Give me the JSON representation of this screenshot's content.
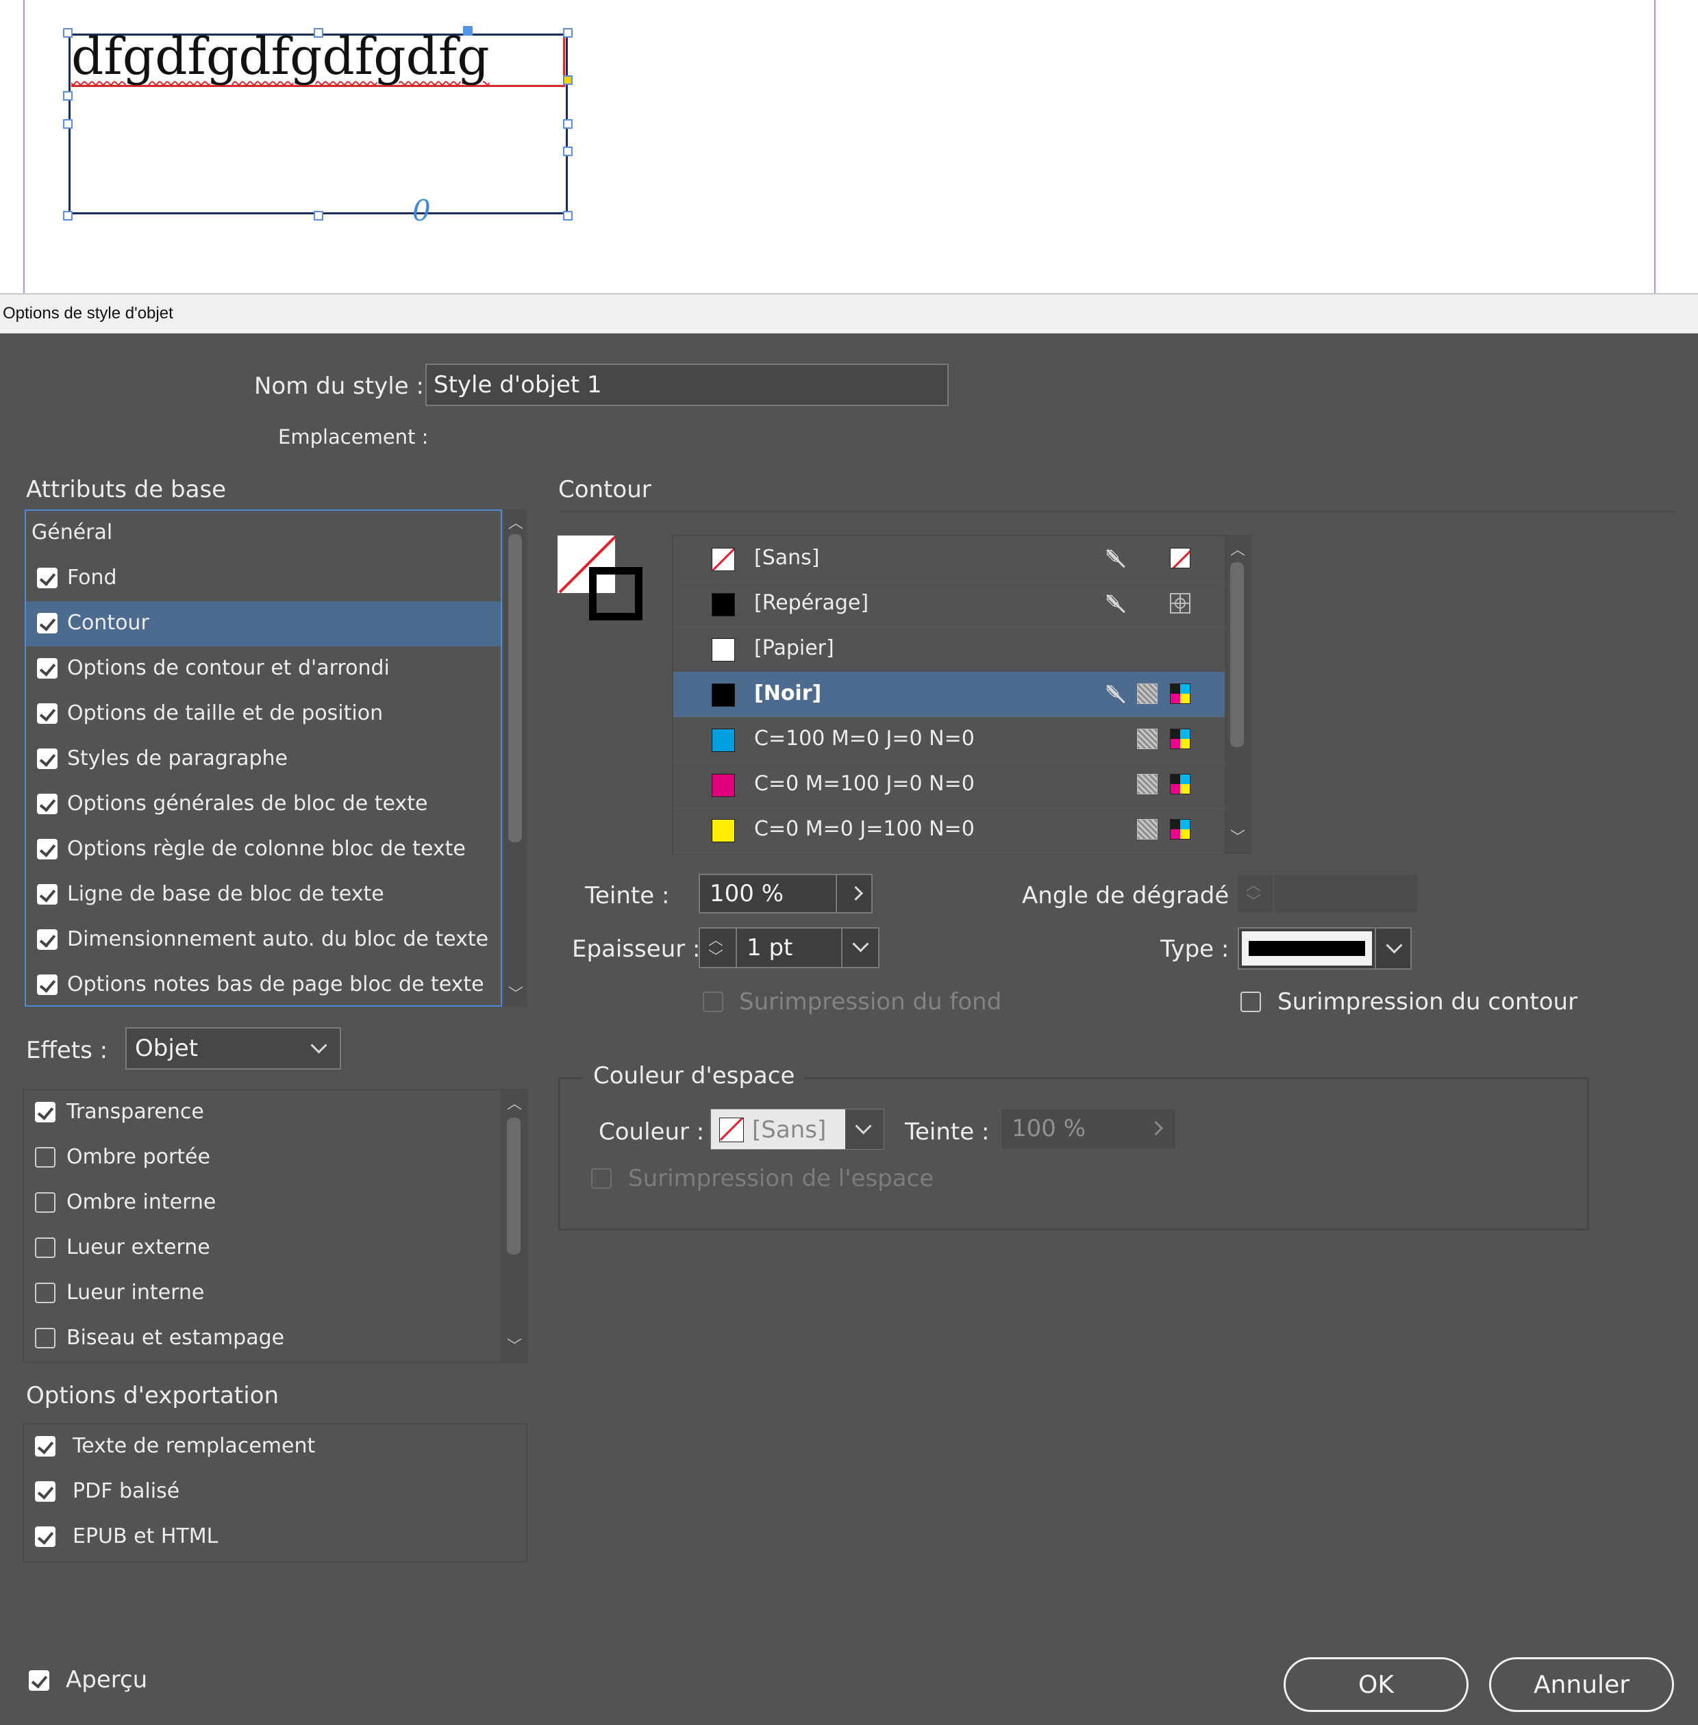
{
  "canvas": {
    "frame_text": "dfgdfgdfgdfgdfg",
    "overflow_marker": "0"
  },
  "window": {
    "title": "Options de style d'objet"
  },
  "style_name": {
    "label": "Nom du style :",
    "value": "Style d'objet 1"
  },
  "location": {
    "label": "Emplacement :"
  },
  "basic_attributes": {
    "heading": "Attributs de base",
    "items": [
      {
        "label": "Général",
        "checkbox": false,
        "checked": false
      },
      {
        "label": "Fond",
        "checkbox": true,
        "checked": true
      },
      {
        "label": "Contour",
        "checkbox": true,
        "checked": true,
        "selected": true
      },
      {
        "label": "Options de contour et d'arrondi",
        "checkbox": true,
        "checked": true
      },
      {
        "label": "Options de taille et de position",
        "checkbox": true,
        "checked": true
      },
      {
        "label": "Styles de paragraphe",
        "checkbox": true,
        "checked": true
      },
      {
        "label": "Options générales de bloc de texte",
        "checkbox": true,
        "checked": true
      },
      {
        "label": "Options règle de colonne bloc de texte",
        "checkbox": true,
        "checked": true
      },
      {
        "label": "Ligne de base de bloc de texte",
        "checkbox": true,
        "checked": true
      },
      {
        "label": "Dimensionnement auto. du bloc de texte",
        "checkbox": true,
        "checked": true
      },
      {
        "label": "Options notes bas de page bloc de texte",
        "checkbox": true,
        "checked": true
      }
    ]
  },
  "effects": {
    "label": "Effets :",
    "target": "Objet",
    "items": [
      {
        "label": "Transparence",
        "checked": true
      },
      {
        "label": "Ombre portée",
        "checked": false
      },
      {
        "label": "Ombre interne",
        "checked": false
      },
      {
        "label": "Lueur externe",
        "checked": false
      },
      {
        "label": "Lueur interne",
        "checked": false
      },
      {
        "label": "Biseau et estampage",
        "checked": false
      }
    ]
  },
  "export_options": {
    "heading": "Options d'exportation",
    "items": [
      {
        "label": "Texte de remplacement",
        "checked": true
      },
      {
        "label": "PDF balisé",
        "checked": true
      },
      {
        "label": "EPUB et HTML",
        "checked": true
      }
    ]
  },
  "stroke_panel": {
    "heading": "Contour",
    "swatches": [
      {
        "name": "[Sans]",
        "color": "none",
        "edit_lock": true,
        "icon": "none-swatch-icon"
      },
      {
        "name": "[Repérage]",
        "color": "#000000",
        "edit_lock": true,
        "icon": "registration-icon"
      },
      {
        "name": "[Papier]",
        "color": "#ffffff",
        "edit_lock": false,
        "icon": ""
      },
      {
        "name": "[Noir]",
        "color": "#000000",
        "edit_lock": true,
        "icon": "process-cmyk-icon",
        "selected": true
      },
      {
        "name": "C=100 M=0 J=0 N=0",
        "color": "#00a0e3",
        "edit_lock": false,
        "icon": "process-cmyk-icon"
      },
      {
        "name": "C=0 M=100 J=0 N=0",
        "color": "#e2007a",
        "edit_lock": false,
        "icon": "process-cmyk-icon"
      },
      {
        "name": "C=0 M=0 J=100 N=0",
        "color": "#ffed00",
        "edit_lock": false,
        "icon": "process-cmyk-icon"
      }
    ],
    "tint": {
      "label": "Teinte :",
      "value": "100 %"
    },
    "gradient_angle": {
      "label": "Angle de dégradé :",
      "value": ""
    },
    "weight": {
      "label": "Epaisseur :",
      "value": "1 pt"
    },
    "type": {
      "label": "Type :"
    },
    "overprint_fill": {
      "label": "Surimpression du fond",
      "checked": false,
      "disabled": true
    },
    "overprint_stroke": {
      "label": "Surimpression du contour",
      "checked": false
    },
    "gap": {
      "heading": "Couleur d'espace",
      "color_label": "Couleur :",
      "color_value": "[Sans]",
      "tint_label": "Teinte :",
      "tint_value": "100 %",
      "overprint_label": "Surimpression de l'espace"
    }
  },
  "footer": {
    "preview_label": "Aperçu",
    "preview_checked": true,
    "ok_label": "OK",
    "cancel_label": "Annuler"
  },
  "colors": {
    "dialog_bg": "#535353",
    "selection": "#4d6a8f",
    "focus_border": "#4f8bd4"
  }
}
